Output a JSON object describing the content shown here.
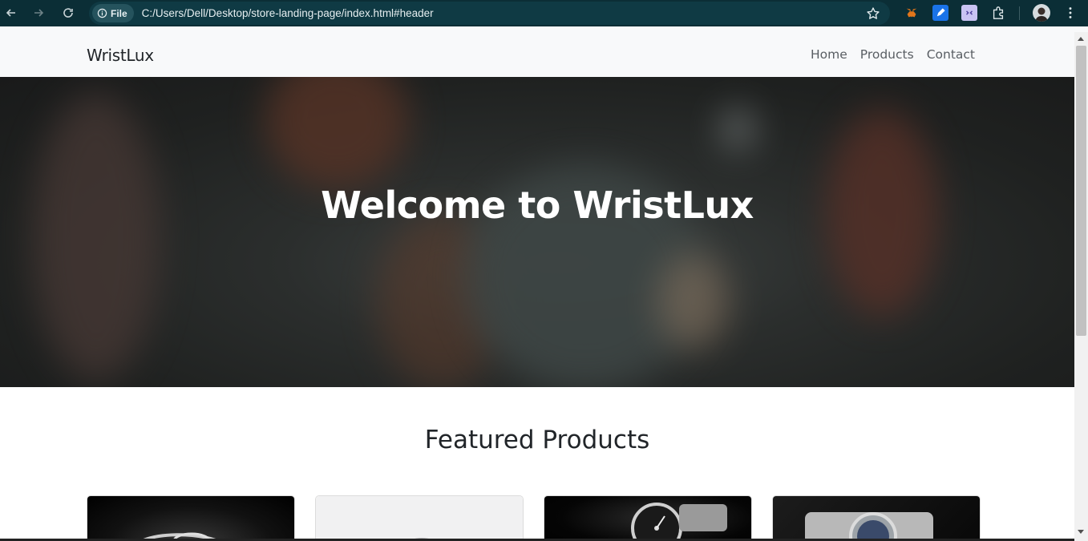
{
  "browser": {
    "site_chip_label": "File",
    "url": "C:/Users/Dell/Desktop/store-landing-page/index.html#header",
    "icons": [
      "back-arrow-icon",
      "forward-arrow-icon",
      "reload-icon",
      "info-icon",
      "star-icon",
      "metamask-icon",
      "edit-extension-icon",
      "extension-icon",
      "puzzle-icon",
      "profile-avatar",
      "more-icon"
    ]
  },
  "navbar": {
    "brand": "WristLux",
    "links": [
      {
        "label": "Home"
      },
      {
        "label": "Products"
      },
      {
        "label": "Contact"
      }
    ]
  },
  "hero": {
    "title": "Welcome to WristLux"
  },
  "featured": {
    "title": "Featured Products",
    "cards": [
      {
        "image": "watch-photo-dark"
      },
      {
        "image": "watch-photo-light"
      },
      {
        "image": "watch-photo-black-dial"
      },
      {
        "image": "watch-photo-blue-dial"
      }
    ]
  },
  "colors": {
    "browser_bar": "#0b2e36",
    "navbar_bg": "#f8f9fa",
    "text_dark": "#212529",
    "nav_link": "#595e63"
  }
}
